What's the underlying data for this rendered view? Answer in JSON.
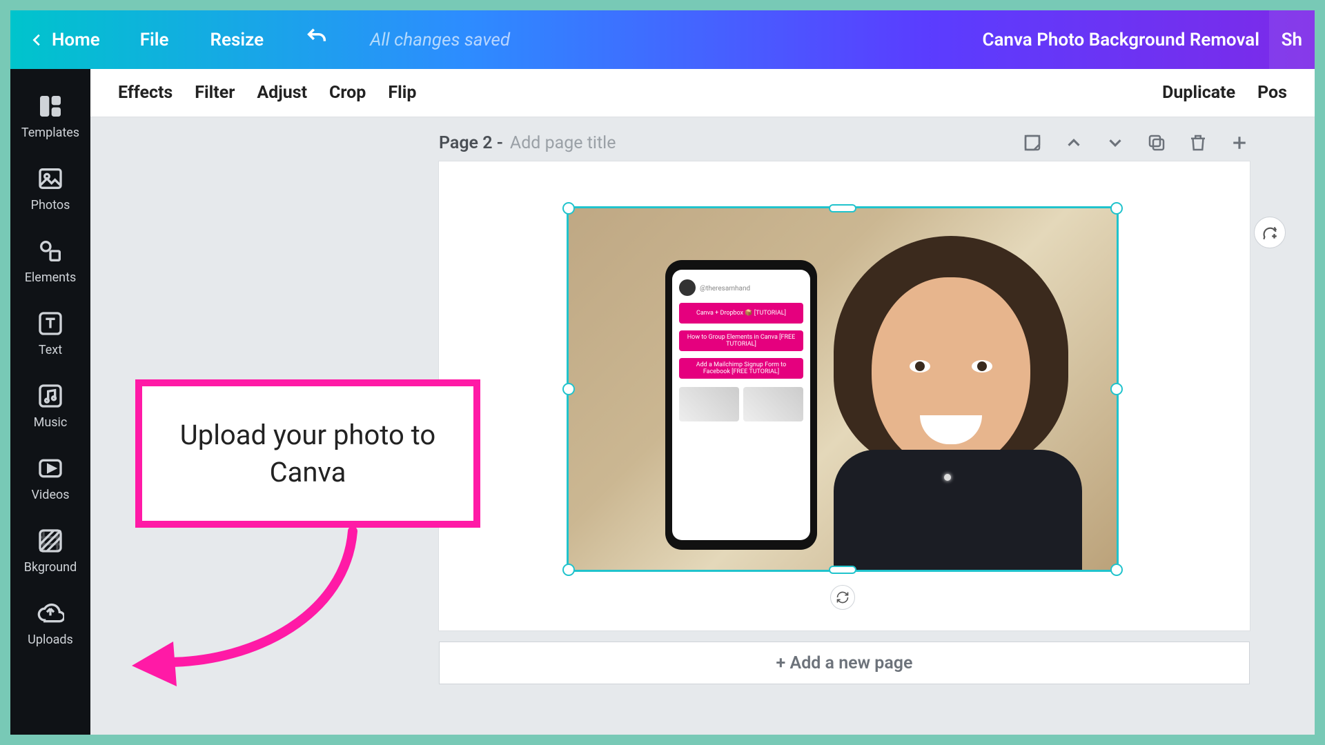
{
  "topbar": {
    "home": "Home",
    "file": "File",
    "resize": "Resize",
    "save_status": "All changes saved",
    "doc_title": "Canva Photo Background Removal",
    "share": "Sh"
  },
  "toolbar2": {
    "effects": "Effects",
    "filter": "Filter",
    "adjust": "Adjust",
    "crop": "Crop",
    "flip": "Flip",
    "duplicate": "Duplicate",
    "position": "Pos"
  },
  "rail": {
    "templates": "Templates",
    "photos": "Photos",
    "elements": "Elements",
    "text": "Text",
    "music": "Music",
    "videos": "Videos",
    "bkground": "Bkground",
    "uploads": "Uploads"
  },
  "page": {
    "label": "Page 2 -",
    "title_placeholder": "Add page title",
    "add_page": "+ Add a new page"
  },
  "phone": {
    "username": "@theresamhand",
    "pill1": "Canva + Dropbox 📦 [TUTORIAL]",
    "pill2": "How to Group Elements in Canva [FREE TUTORIAL]",
    "pill3": "Add a Mailchimp Signup Form to Facebook [FREE TUTORIAL]"
  },
  "annotation": {
    "callout": "Upload your photo to Canva"
  }
}
